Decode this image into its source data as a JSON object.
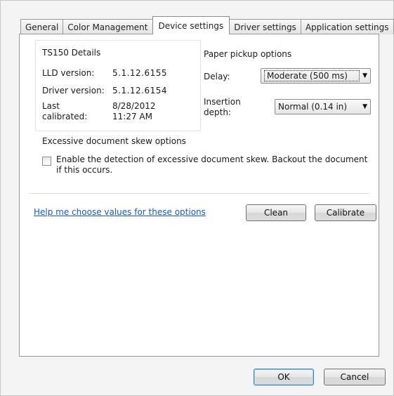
{
  "tabs": [
    {
      "label": "General"
    },
    {
      "label": "Color Management"
    },
    {
      "label": "Device settings"
    },
    {
      "label": "Driver settings"
    },
    {
      "label": "Application settings"
    }
  ],
  "details": {
    "title": "TS150 Details",
    "lld_label": "LLD version:",
    "lld_value": "5.1.12.6155",
    "driver_label": "Driver version:",
    "driver_value": "5.1.12.6154",
    "calibrated_label": "Last calibrated:",
    "calibrated_value": "8/28/2012 11:27 AM"
  },
  "pickup": {
    "title": "Paper pickup options",
    "delay_label": "Delay:",
    "delay_value": "Moderate (500 ms)",
    "depth_label": "Insertion depth:",
    "depth_value": "Normal (0.14 in)"
  },
  "skew": {
    "title": "Excessive document skew options",
    "checkbox_label": "Enable the detection of excessive document skew. Backout the document if this occurs.",
    "checked": false
  },
  "help_link": "Help me choose values for these options",
  "buttons": {
    "clean": "Clean",
    "calibrate": "Calibrate",
    "ok": "OK",
    "cancel": "Cancel"
  }
}
